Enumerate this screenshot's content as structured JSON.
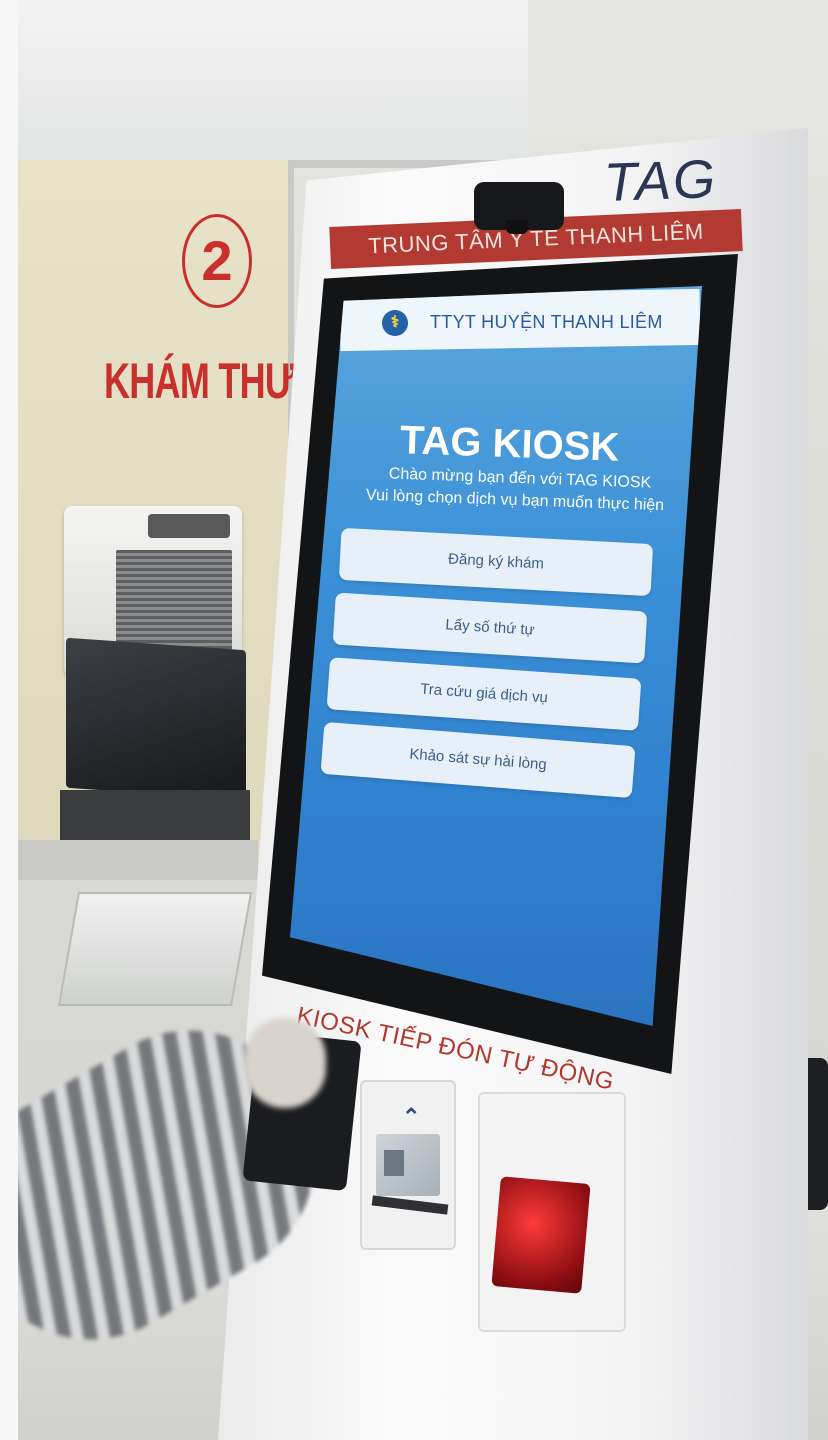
{
  "kiosk": {
    "brand": "TAG",
    "top_banner": "TRUNG TÂM Y TẾ THANH LIÊM",
    "bottom_banner": "KIOSK TIẾP ĐÓN TỰ ĐỘNG"
  },
  "booth": {
    "door_number": "2",
    "sign": "KHÁM THƯỜ"
  },
  "screen": {
    "hospital_name": "TTYT HUYỆN THANH LIÊM",
    "app_title": "TAG KIOSK",
    "welcome": "Chào mừng bạn đến với TAG KIOSK",
    "instruction": "Vui lòng chọn dịch vụ bạn muốn thực hiện",
    "menu": [
      {
        "label": "Đăng ký khám"
      },
      {
        "label": "Lấy số thứ tự"
      },
      {
        "label": "Tra cứu giá dịch vụ"
      },
      {
        "label": "Khảo sát sự hài lòng"
      }
    ]
  },
  "colors": {
    "screen_blue": "#3a8fd6",
    "banner_red": "#b23a32",
    "brand_navy": "#2a3653"
  },
  "icons": [
    "health-ministry-logo-icon",
    "up-arrow-icon"
  ]
}
